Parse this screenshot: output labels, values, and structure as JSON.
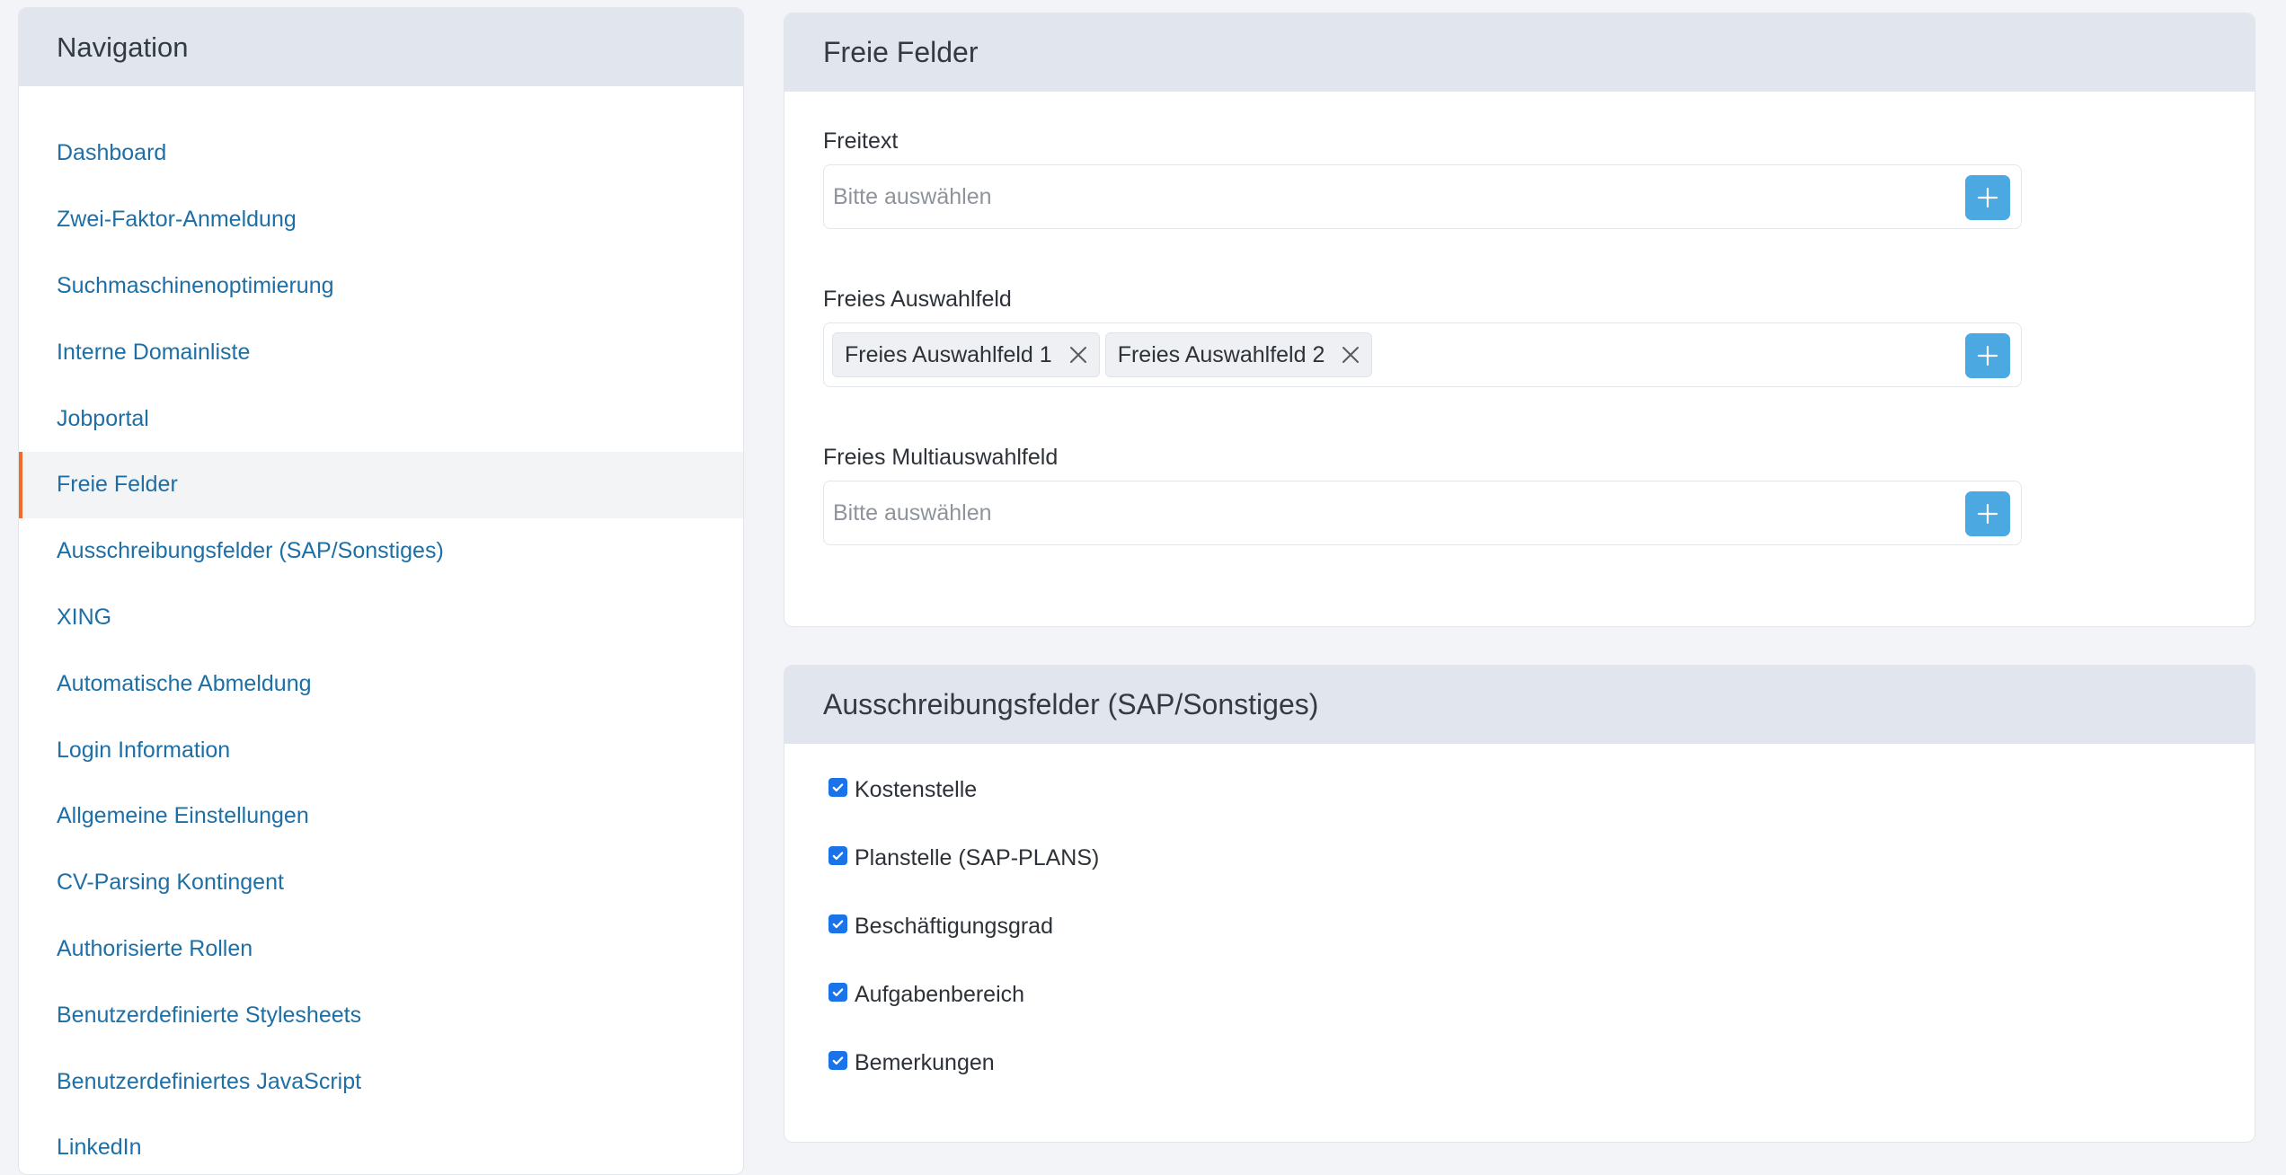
{
  "sidebar": {
    "title": "Navigation",
    "items": [
      {
        "label": "Dashboard",
        "active": false
      },
      {
        "label": "Zwei-Faktor-Anmeldung",
        "active": false
      },
      {
        "label": "Suchmaschinenoptimierung",
        "active": false
      },
      {
        "label": "Interne Domainliste",
        "active": false
      },
      {
        "label": "Jobportal",
        "active": false
      },
      {
        "label": "Freie Felder",
        "active": true
      },
      {
        "label": "Ausschreibungsfelder (SAP/Sonstiges)",
        "active": false
      },
      {
        "label": "XING",
        "active": false
      },
      {
        "label": "Automatische Abmeldung",
        "active": false
      },
      {
        "label": "Login Information",
        "active": false
      },
      {
        "label": "Allgemeine Einstellungen",
        "active": false
      },
      {
        "label": "CV-Parsing Kontingent",
        "active": false
      },
      {
        "label": "Authorisierte Rollen",
        "active": false
      },
      {
        "label": "Benutzerdefinierte Stylesheets",
        "active": false
      },
      {
        "label": "Benutzerdefiniertes JavaScript",
        "active": false
      },
      {
        "label": "LinkedIn",
        "active": false
      }
    ]
  },
  "free_fields": {
    "title": "Freie Felder",
    "freitext": {
      "label": "Freitext",
      "placeholder": "Bitte auswählen"
    },
    "auswahlfeld": {
      "label": "Freies Auswahlfeld",
      "tags": [
        "Freies Auswahlfeld 1",
        "Freies Auswahlfeld 2"
      ]
    },
    "multiauswahlfeld": {
      "label": "Freies Multiauswahlfeld",
      "placeholder": "Bitte auswählen"
    }
  },
  "tender_fields": {
    "title": "Ausschreibungsfelder (SAP/Sonstiges)",
    "options": [
      {
        "label": "Kostenstelle",
        "checked": true
      },
      {
        "label": "Planstelle (SAP-PLANS)",
        "checked": true
      },
      {
        "label": "Beschäftigungsgrad",
        "checked": true
      },
      {
        "label": "Aufgabenbereich",
        "checked": true
      },
      {
        "label": "Bemerkungen",
        "checked": true
      }
    ]
  },
  "colors": {
    "accent": "#f26b2b",
    "link": "#1d6fa5",
    "button": "#4ba8e0",
    "checkbox": "#1a73e8",
    "header_bg": "#e1e6ee"
  },
  "icons": {
    "add": "plus-icon",
    "remove_tag": "close-icon",
    "checkbox": "checkmark-icon"
  }
}
